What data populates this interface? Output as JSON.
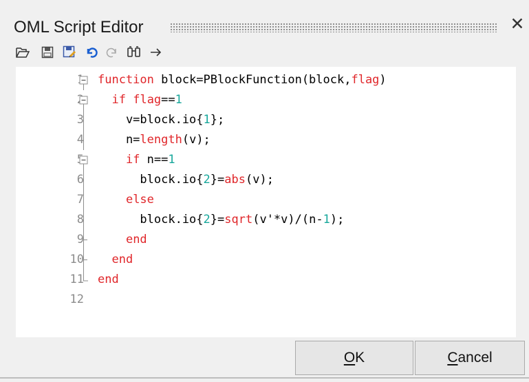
{
  "window": {
    "title": "OML Script Editor",
    "close_glyph": "✕"
  },
  "toolbar": {
    "items": [
      {
        "name": "open-folder-icon"
      },
      {
        "name": "save-icon"
      },
      {
        "name": "save-as-icon"
      },
      {
        "name": "undo-icon"
      },
      {
        "name": "redo-icon"
      },
      {
        "name": "find-icon"
      },
      {
        "name": "arrow-right-icon"
      }
    ]
  },
  "editor": {
    "lines": [
      {
        "n": "1",
        "tokens": [
          [
            "kw",
            "function"
          ],
          [
            "pl",
            " block=PBlockFunction(block,"
          ],
          [
            "kw",
            "flag"
          ],
          [
            "pl",
            ")"
          ]
        ],
        "fold": "open"
      },
      {
        "n": "2",
        "tokens": [
          [
            "pl",
            "  "
          ],
          [
            "kw",
            "if"
          ],
          [
            "pl",
            " "
          ],
          [
            "kw",
            "flag"
          ],
          [
            "pl",
            "=="
          ],
          [
            "num",
            "1"
          ]
        ],
        "fold": "open"
      },
      {
        "n": "3",
        "tokens": [
          [
            "pl",
            "    v=block.io{"
          ],
          [
            "num",
            "1"
          ],
          [
            "pl",
            "};"
          ]
        ],
        "fold": "line"
      },
      {
        "n": "4",
        "tokens": [
          [
            "pl",
            "    n="
          ],
          [
            "fn",
            "length"
          ],
          [
            "pl",
            "(v);"
          ]
        ],
        "fold": "line"
      },
      {
        "n": "5",
        "tokens": [
          [
            "pl",
            "    "
          ],
          [
            "kw",
            "if"
          ],
          [
            "pl",
            " n=="
          ],
          [
            "num",
            "1"
          ]
        ],
        "fold": "open"
      },
      {
        "n": "6",
        "tokens": [
          [
            "pl",
            "      block.io{"
          ],
          [
            "num",
            "2"
          ],
          [
            "pl",
            "}="
          ],
          [
            "fn",
            "abs"
          ],
          [
            "pl",
            "(v);"
          ]
        ],
        "fold": "line"
      },
      {
        "n": "7",
        "tokens": [
          [
            "pl",
            "    "
          ],
          [
            "kw",
            "else"
          ]
        ],
        "fold": "line"
      },
      {
        "n": "8",
        "tokens": [
          [
            "pl",
            "      block.io{"
          ],
          [
            "num",
            "2"
          ],
          [
            "pl",
            "}="
          ],
          [
            "fn",
            "sqrt"
          ],
          [
            "pl",
            "(v'*v)/(n-"
          ],
          [
            "num",
            "1"
          ],
          [
            "pl",
            ");"
          ]
        ],
        "fold": "line"
      },
      {
        "n": "9",
        "tokens": [
          [
            "pl",
            "    "
          ],
          [
            "kw",
            "end"
          ]
        ],
        "fold": "tick"
      },
      {
        "n": "10",
        "tokens": [
          [
            "pl",
            "  "
          ],
          [
            "kw",
            "end"
          ]
        ],
        "fold": "tick"
      },
      {
        "n": "11",
        "tokens": [
          [
            "kw",
            "end"
          ]
        ],
        "fold": "close"
      },
      {
        "n": "12",
        "tokens": [],
        "fold": "none"
      }
    ]
  },
  "buttons": {
    "ok": {
      "mnemonic": "O",
      "rest": "K"
    },
    "cancel": {
      "mnemonic": "C",
      "rest": "ancel"
    }
  },
  "colors": {
    "keyword": "#e0262a",
    "number": "#17a79b",
    "line_number": "#8c8c8c",
    "undo_blue": "#1a5fd1"
  }
}
